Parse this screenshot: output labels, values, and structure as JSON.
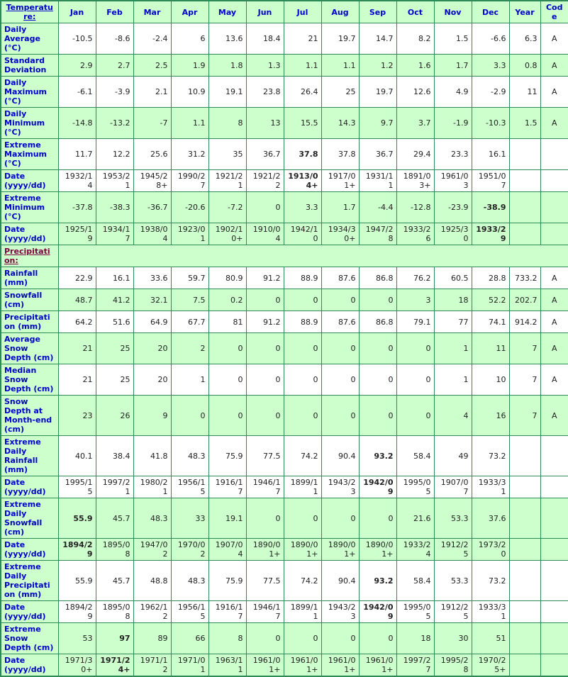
{
  "table": {
    "columns": [
      "",
      "Jan",
      "Feb",
      "Mar",
      "Apr",
      "May",
      "Jun",
      "Jul",
      "Aug",
      "Sep",
      "Oct",
      "Nov",
      "Dec",
      "Year",
      "Code"
    ],
    "header_label": "Temperature:",
    "sections": [
      {
        "title": "Temperature:",
        "rows": [
          {
            "label": "Daily Average (°C)",
            "band": "white",
            "values": [
              "-10.5",
              "-8.6",
              "-2.4",
              "6",
              "13.6",
              "18.4",
              "21",
              "19.7",
              "14.7",
              "8.2",
              "1.5",
              "-6.6",
              "6.3",
              "A"
            ],
            "bold": []
          },
          {
            "label": "Standard Deviation",
            "band": "green",
            "values": [
              "2.9",
              "2.7",
              "2.5",
              "1.9",
              "1.8",
              "1.3",
              "1.1",
              "1.1",
              "1.2",
              "1.6",
              "1.7",
              "3.3",
              "0.8",
              "A"
            ],
            "bold": []
          },
          {
            "label": "Daily Maximum (°C)",
            "band": "white",
            "values": [
              "-6.1",
              "-3.9",
              "2.1",
              "10.9",
              "19.1",
              "23.8",
              "26.4",
              "25",
              "19.7",
              "12.6",
              "4.9",
              "-2.9",
              "11",
              "A"
            ],
            "bold": []
          },
          {
            "label": "Daily Minimum (°C)",
            "band": "green",
            "values": [
              "-14.8",
              "-13.2",
              "-7",
              "1.1",
              "8",
              "13",
              "15.5",
              "14.3",
              "9.7",
              "3.7",
              "-1.9",
              "-10.3",
              "1.5",
              "A"
            ],
            "bold": []
          },
          {
            "label": "Extreme Maximum (°C)",
            "band": "white",
            "sep": true,
            "values": [
              "11.7",
              "12.2",
              "25.6",
              "31.2",
              "35",
              "36.7",
              "37.8",
              "37.8",
              "36.7",
              "29.4",
              "23.3",
              "16.1",
              "",
              ""
            ],
            "bold": [
              6
            ]
          },
          {
            "label": "Date (yyyy/dd)",
            "band": "white",
            "values": [
              "1932/14",
              "1953/21",
              "1945/28+",
              "1990/27",
              "1921/21",
              "1921/22",
              "1913/04+",
              "1917/01+",
              "1931/11",
              "1891/03+",
              "1961/03",
              "1951/07",
              "",
              ""
            ],
            "bold": [
              6
            ]
          },
          {
            "label": "Extreme Minimum (°C)",
            "band": "green",
            "values": [
              "-37.8",
              "-38.3",
              "-36.7",
              "-20.6",
              "-7.2",
              "0",
              "3.3",
              "1.7",
              "-4.4",
              "-12.8",
              "-23.9",
              "-38.9",
              "",
              ""
            ],
            "bold": [
              11
            ]
          },
          {
            "label": "Date (yyyy/dd)",
            "band": "green",
            "values": [
              "1925/19",
              "1934/17",
              "1938/04",
              "1923/01",
              "1902/10+",
              "1910/04",
              "1942/10",
              "1934/30+",
              "1947/28",
              "1933/26",
              "1925/30",
              "1933/29",
              "",
              ""
            ],
            "bold": [
              11
            ]
          }
        ]
      },
      {
        "title": "Precipitation:",
        "rows": [
          {
            "label": "Rainfall (mm)",
            "band": "white",
            "values": [
              "22.9",
              "16.1",
              "33.6",
              "59.7",
              "80.9",
              "91.2",
              "88.9",
              "87.6",
              "86.8",
              "76.2",
              "60.5",
              "28.8",
              "733.2",
              "A"
            ],
            "bold": []
          },
          {
            "label": "Snowfall (cm)",
            "band": "green",
            "values": [
              "48.7",
              "41.2",
              "32.1",
              "7.5",
              "0.2",
              "0",
              "0",
              "0",
              "0",
              "3",
              "18",
              "52.2",
              "202.7",
              "A"
            ],
            "bold": []
          },
          {
            "label": "Precipitation (mm)",
            "band": "white",
            "values": [
              "64.2",
              "51.6",
              "64.9",
              "67.7",
              "81",
              "91.2",
              "88.9",
              "87.6",
              "86.8",
              "79.1",
              "77",
              "74.1",
              "914.2",
              "A"
            ],
            "bold": []
          },
          {
            "label": "Average Snow Depth (cm)",
            "band": "green",
            "values": [
              "21",
              "25",
              "20",
              "2",
              "0",
              "0",
              "0",
              "0",
              "0",
              "0",
              "1",
              "11",
              "7",
              "A"
            ],
            "bold": []
          },
          {
            "label": "Median Snow Depth (cm)",
            "band": "white",
            "values": [
              "21",
              "25",
              "20",
              "1",
              "0",
              "0",
              "0",
              "0",
              "0",
              "0",
              "1",
              "10",
              "7",
              "A"
            ],
            "bold": []
          },
          {
            "label": "Snow Depth at Month-end (cm)",
            "band": "green",
            "values": [
              "23",
              "26",
              "9",
              "0",
              "0",
              "0",
              "0",
              "0",
              "0",
              "0",
              "4",
              "16",
              "7",
              "A"
            ],
            "bold": []
          },
          {
            "label": "Extreme Daily Rainfall (mm)",
            "band": "white",
            "sep": true,
            "values": [
              "40.1",
              "38.4",
              "41.8",
              "48.3",
              "75.9",
              "77.5",
              "74.2",
              "90.4",
              "93.2",
              "58.4",
              "49",
              "73.2",
              "",
              ""
            ],
            "bold": [
              8
            ]
          },
          {
            "label": "Date (yyyy/dd)",
            "band": "white",
            "values": [
              "1995/15",
              "1997/21",
              "1980/21",
              "1956/15",
              "1916/17",
              "1946/17",
              "1899/11",
              "1943/23",
              "1942/09",
              "1995/05",
              "1907/07",
              "1933/31",
              "",
              ""
            ],
            "bold": [
              8
            ]
          },
          {
            "label": "Extreme Daily Snowfall (cm)",
            "band": "green",
            "values": [
              "55.9",
              "45.7",
              "48.3",
              "33",
              "19.1",
              "0",
              "0",
              "0",
              "0",
              "21.6",
              "53.3",
              "37.6",
              "",
              ""
            ],
            "bold": [
              0
            ]
          },
          {
            "label": "Date (yyyy/dd)",
            "band": "green",
            "values": [
              "1894/29",
              "1895/08",
              "1947/02",
              "1970/02",
              "1907/04",
              "1890/01+",
              "1890/01+",
              "1890/01+",
              "1890/01+",
              "1933/24",
              "1912/25",
              "1973/20",
              "",
              ""
            ],
            "bold": [
              0
            ]
          },
          {
            "label": "Extreme Daily Precipitation (mm)",
            "band": "white",
            "values": [
              "55.9",
              "45.7",
              "48.8",
              "48.3",
              "75.9",
              "77.5",
              "74.2",
              "90.4",
              "93.2",
              "58.4",
              "53.3",
              "73.2",
              "",
              ""
            ],
            "bold": [
              8
            ]
          },
          {
            "label": "Date (yyyy/dd)",
            "band": "white",
            "values": [
              "1894/29",
              "1895/08",
              "1962/12",
              "1956/15",
              "1916/17",
              "1946/17",
              "1899/11",
              "1943/23",
              "1942/09",
              "1995/05",
              "1912/25",
              "1933/31",
              "",
              ""
            ],
            "bold": [
              8
            ]
          },
          {
            "label": "Extreme Snow Depth (cm)",
            "band": "green",
            "values": [
              "53",
              "97",
              "89",
              "66",
              "8",
              "0",
              "0",
              "0",
              "0",
              "18",
              "30",
              "51",
              "",
              ""
            ],
            "bold": [
              1
            ]
          },
          {
            "label": "Date (yyyy/dd)",
            "band": "green",
            "values": [
              "1971/30+",
              "1971/24+",
              "1971/12",
              "1971/01",
              "1963/11",
              "1961/01+",
              "1961/01+",
              "1961/01+",
              "1961/01+",
              "1997/27",
              "1995/28",
              "1970/25+",
              "",
              ""
            ],
            "bold": [
              1
            ]
          }
        ]
      }
    ]
  },
  "colors": {
    "grid": "#2e8b57",
    "band_green": "#ccffcc",
    "band_white": "#ffffff",
    "label_text": "#0000cc",
    "section_text": "#800040"
  }
}
